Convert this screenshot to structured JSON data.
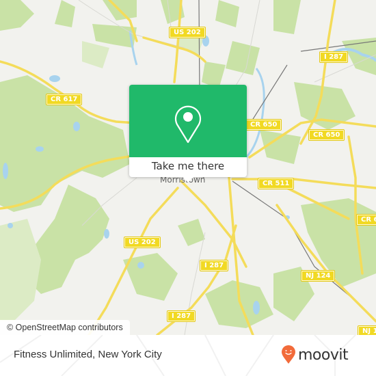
{
  "map": {
    "town_label": "Morristown",
    "attribution": "© OpenStreetMap contributors",
    "colors": {
      "background": "#f2f2ee",
      "park": "#c9e2a6",
      "park_light": "#dcebc5",
      "water": "#a8d3ee",
      "road_major": "#f4dc5a",
      "road_minor": "#ffffff",
      "rail": "#777777",
      "shield": "#f1d923"
    },
    "road_labels": [
      {
        "id": "us202-north",
        "text": "US 202"
      },
      {
        "id": "cr617",
        "text": "CR 617"
      },
      {
        "id": "i287-north",
        "text": "I 287"
      },
      {
        "id": "cr650-west",
        "text": "CR 650"
      },
      {
        "id": "cr650-east",
        "text": "CR 650"
      },
      {
        "id": "cr511",
        "text": "CR 511"
      },
      {
        "id": "cr6-east",
        "text": "CR 6"
      },
      {
        "id": "us202-south",
        "text": "US 202"
      },
      {
        "id": "i287-mid",
        "text": "I 287"
      },
      {
        "id": "nj124",
        "text": "NJ 124"
      },
      {
        "id": "i287-south",
        "text": "I 287"
      },
      {
        "id": "nj1-edge",
        "text": "NJ 1"
      }
    ]
  },
  "popup": {
    "icon": "map-pin-icon",
    "cta_label": "Take me there",
    "color": "#20b96a"
  },
  "footer": {
    "place_name": "Fitness Unlimited, New York City",
    "brand": "moovit",
    "brand_icon": "moovit-pin-logo-icon",
    "brand_color": "#f26b3a"
  }
}
